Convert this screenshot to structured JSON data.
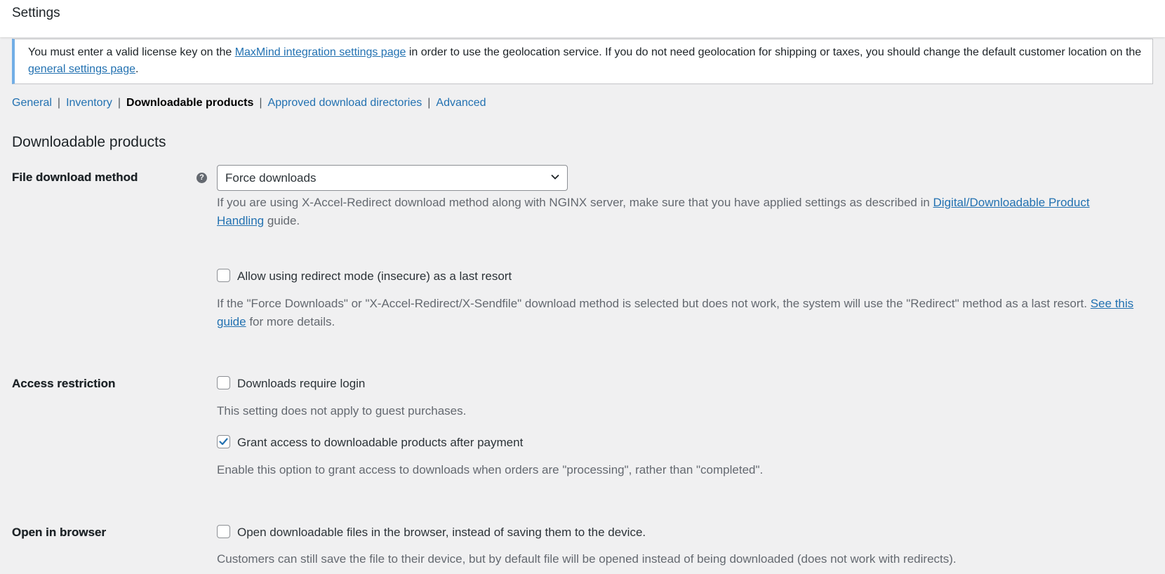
{
  "header": {
    "title": "Settings"
  },
  "notice": {
    "text_1": "You must enter a valid license key on the ",
    "link_1": "MaxMind integration settings page",
    "text_2": " in order to use the geolocation service. If you do not need geolocation for shipping or taxes, you should change the default customer location on the ",
    "link_2": "general settings page",
    "text_3": "."
  },
  "subnav": {
    "items": [
      {
        "label": "General"
      },
      {
        "label": "Inventory"
      },
      {
        "label": "Downloadable products"
      },
      {
        "label": "Approved download directories"
      },
      {
        "label": "Advanced"
      }
    ],
    "separator": "|",
    "current_index": 2
  },
  "section": {
    "title": "Downloadable products"
  },
  "file_download_method": {
    "label": "File download method",
    "help_icon": "question-circle-icon",
    "select_value": "Force downloads",
    "desc_1": "If you are using X-Accel-Redirect download method along with NGINX server, make sure that you have applied settings as described in ",
    "desc_link": "Digital/Downloadable Product Handling",
    "desc_2": " guide.",
    "redirect_checkbox": {
      "label": "Allow using redirect mode (insecure) as a last resort",
      "checked": false
    },
    "redirect_desc_1": "If the \"Force Downloads\" or \"X-Accel-Redirect/X-Sendfile\" download method is selected but does not work, the system will use the \"Redirect\" method as a last resort. ",
    "redirect_desc_link": "See this guide",
    "redirect_desc_2": " for more details."
  },
  "access_restriction": {
    "label": "Access restriction",
    "require_login": {
      "label": "Downloads require login",
      "checked": false
    },
    "require_login_desc": "This setting does not apply to guest purchases.",
    "grant_access": {
      "label": "Grant access to downloadable products after payment",
      "checked": true
    },
    "grant_access_desc": "Enable this option to grant access to downloads when orders are \"processing\", rather than \"completed\"."
  },
  "open_in_browser": {
    "label": "Open in browser",
    "checkbox": {
      "label": "Open downloadable files in the browser, instead of saving them to the device.",
      "checked": false
    },
    "desc": "Customers can still save the file to their device, but by default file will be opened instead of being downloaded (does not work with redirects)."
  },
  "colors": {
    "link": "#2271b1",
    "notice_border": "#72aee6",
    "page_bg": "#f0f0f1",
    "checkbox_check": "#2271b1"
  }
}
